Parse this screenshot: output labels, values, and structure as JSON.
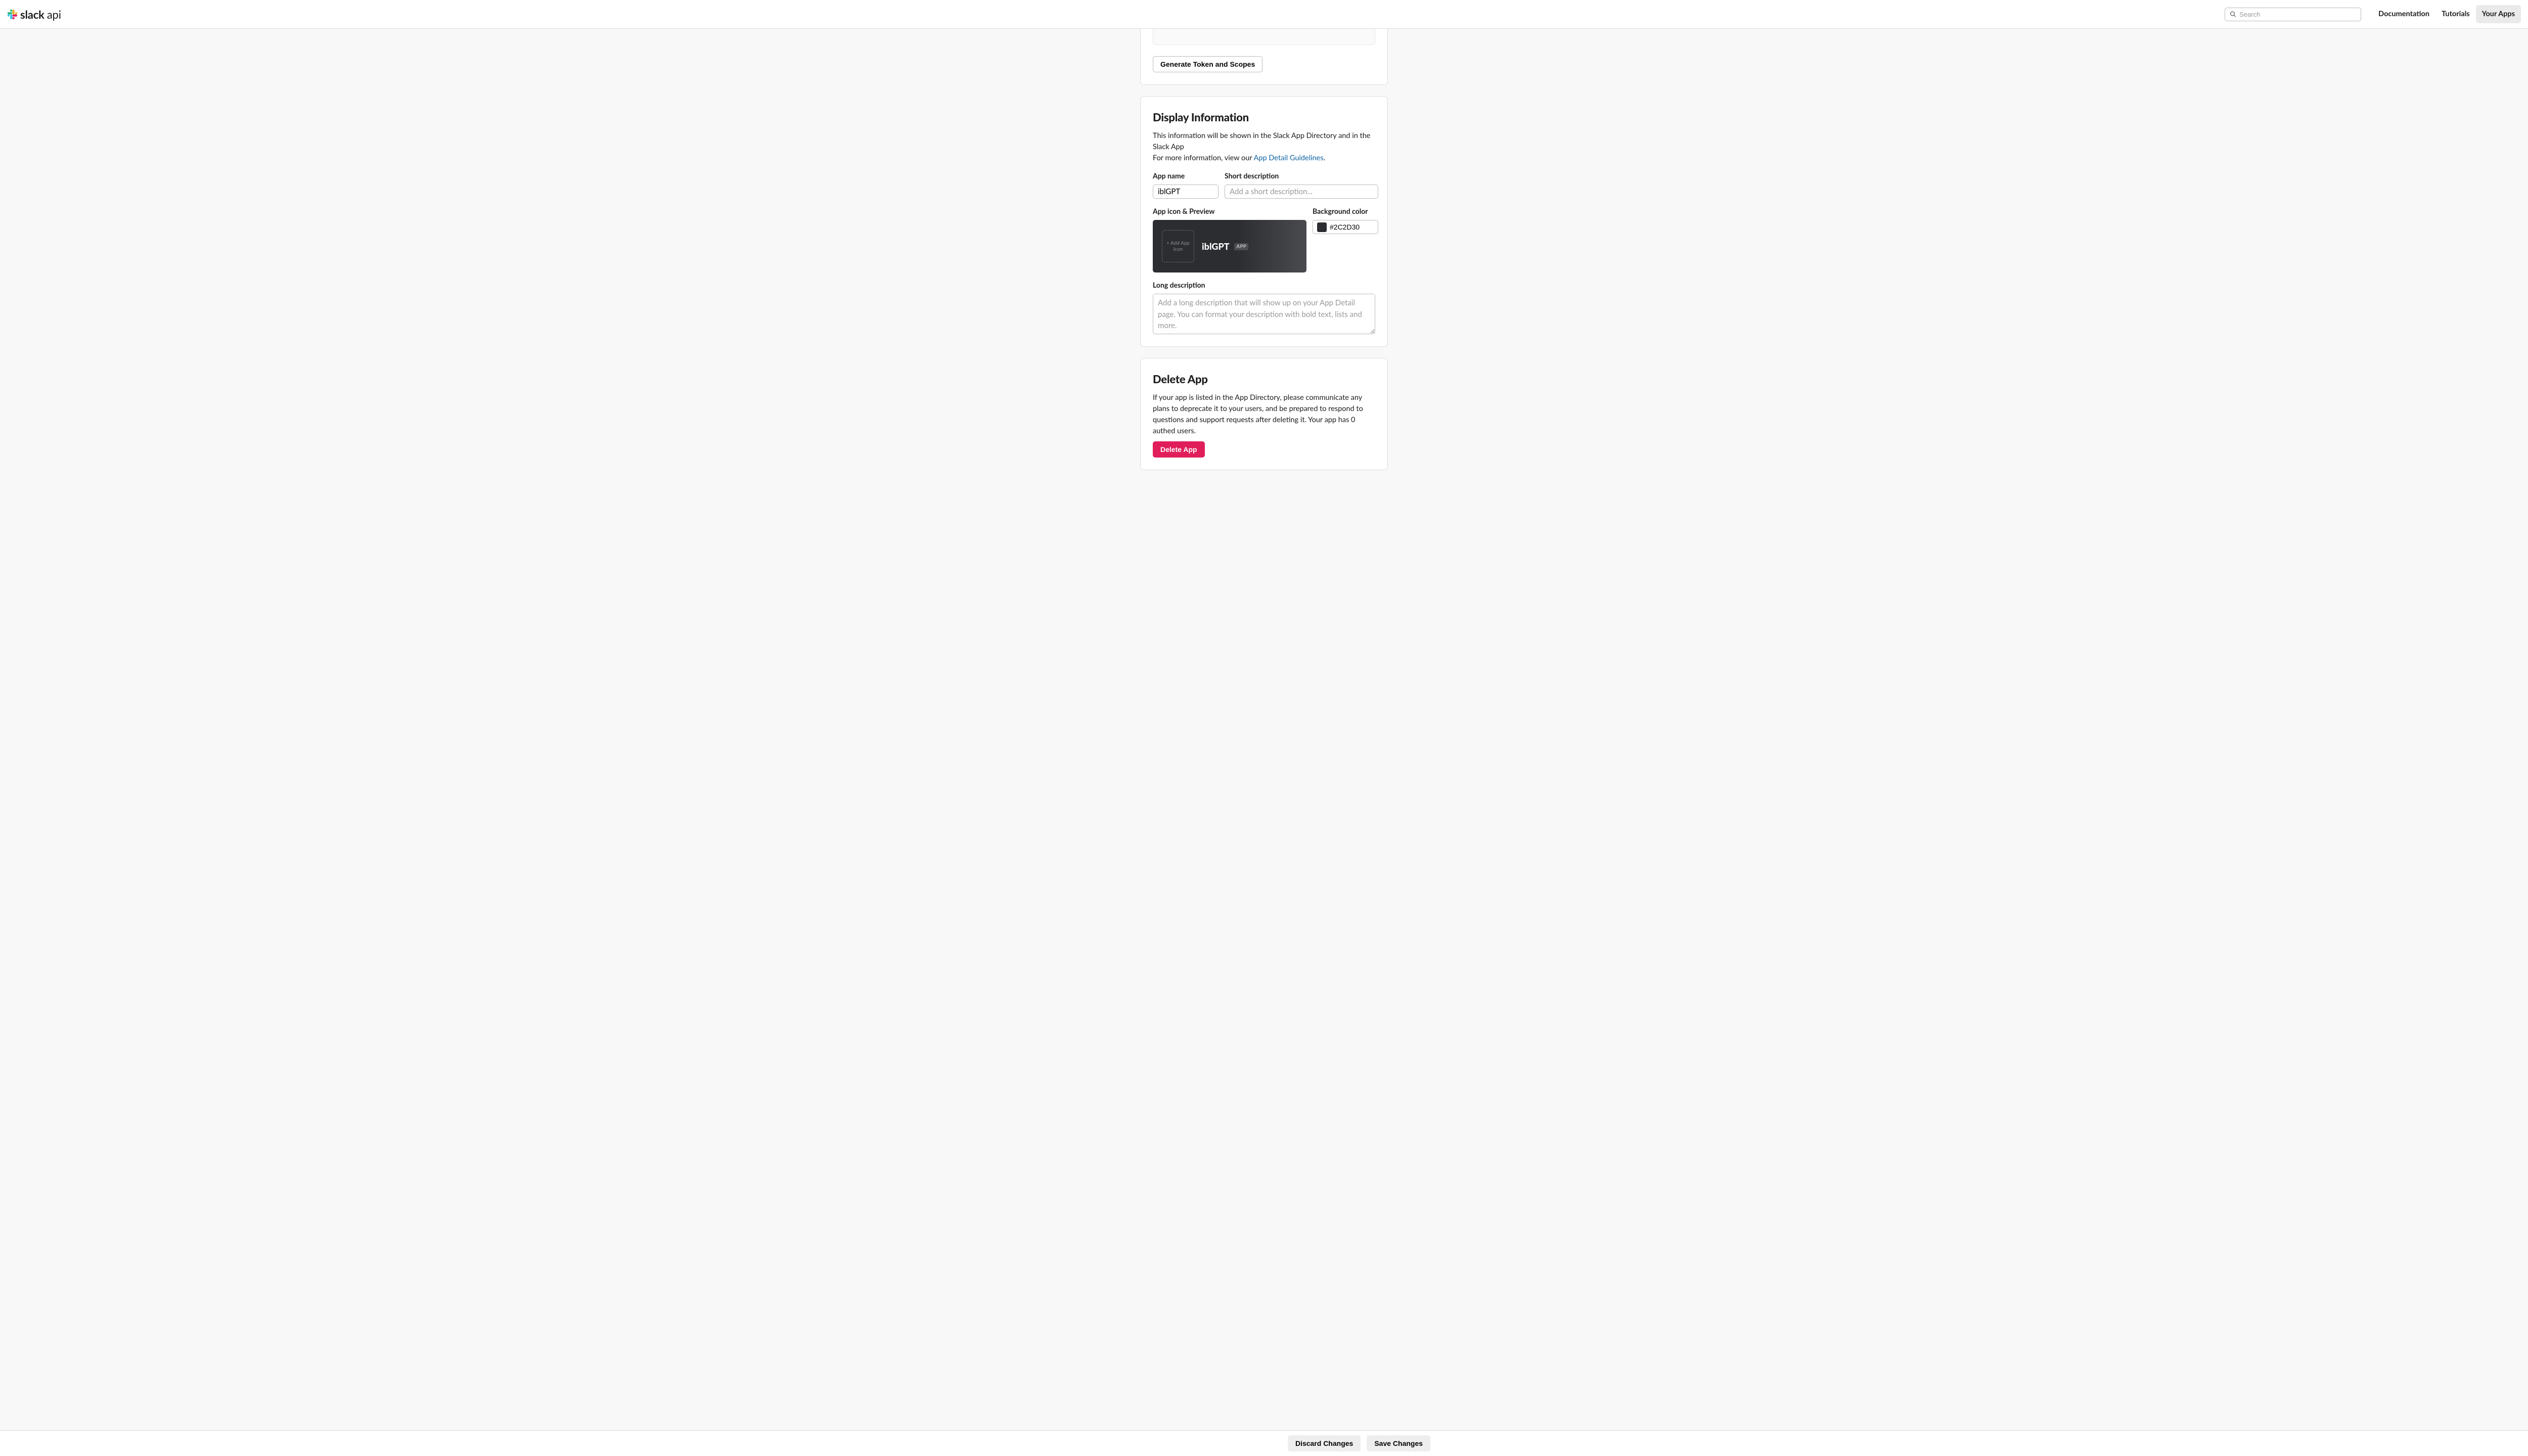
{
  "header": {
    "brand_primary": "slack",
    "brand_secondary": "api",
    "search_placeholder": "Search",
    "nav": {
      "documentation": "Documentation",
      "tutorials": "Tutorials",
      "your_apps": "Your Apps"
    }
  },
  "token_card": {
    "generate_button": "Generate Token and Scopes"
  },
  "display_card": {
    "heading": "Display Information",
    "intro_line1": "This information will be shown in the Slack App Directory and in the Slack App",
    "intro_line2_a": "For more information, view our ",
    "intro_link": "App Detail Guidelines",
    "intro_line2_b": ".",
    "app_name_label": "App name",
    "app_name_value": "iblGPT",
    "short_desc_label": "Short description",
    "short_desc_placeholder": "Add a short description...",
    "icon_label": "App icon & Preview",
    "icon_drop_text": "+ Add App Icon",
    "preview_name": "iblGPT",
    "app_badge": "APP",
    "bg_label": "Background color",
    "bg_value": "#2C2D30",
    "long_desc_label": "Long description",
    "long_desc_placeholder": "Add a long description that will show up on your App Detail page. You can format your description with bold text, lists and more."
  },
  "delete_card": {
    "heading": "Delete App",
    "body": "If your app is listed in the App Directory, please communicate any plans to deprecate it to your users, and be prepared to respond to questions and support requests after deleting it. Your app has 0 authed users.",
    "button": "Delete App"
  },
  "footer": {
    "discard": "Discard Changes",
    "save": "Save Changes"
  }
}
